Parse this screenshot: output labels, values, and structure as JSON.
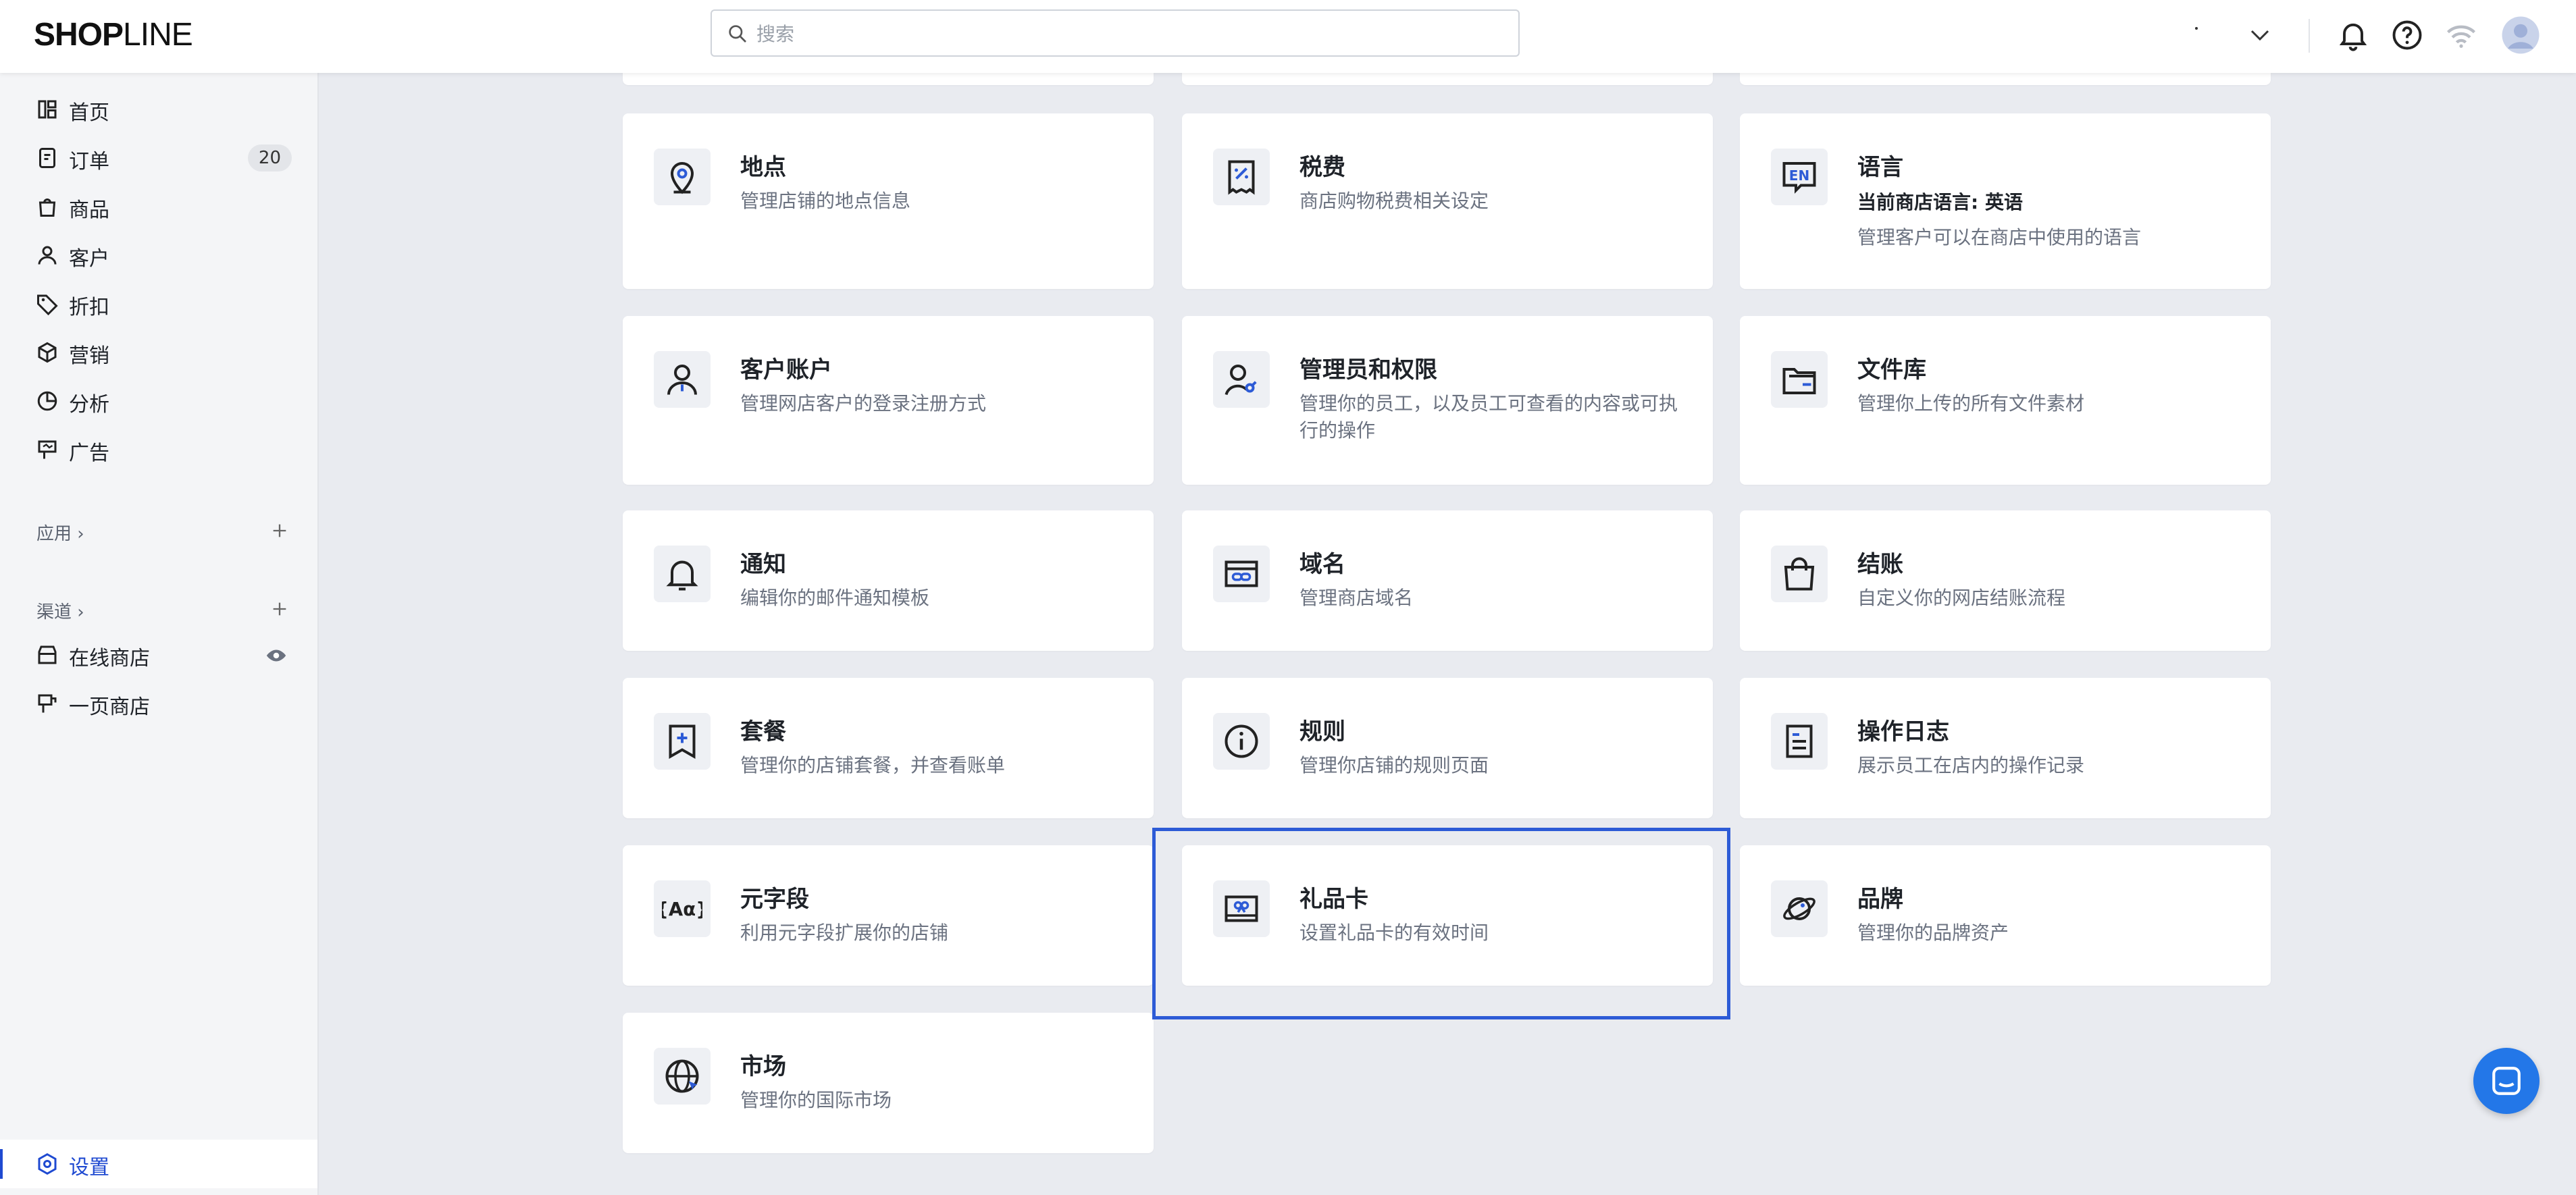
{
  "brand": {
    "logo_bold": "SHOP",
    "logo_thin": "LINE"
  },
  "search": {
    "placeholder": "搜索"
  },
  "colors": {
    "accent": "#1f4ad1",
    "highlight": "#2d5bd6",
    "chat": "#2377e8"
  },
  "sidebar": {
    "items": [
      {
        "label": "首页",
        "icon": "home-icon"
      },
      {
        "label": "订单",
        "icon": "order-icon",
        "badge": "20"
      },
      {
        "label": "商品",
        "icon": "bag-icon"
      },
      {
        "label": "客户",
        "icon": "person-icon"
      },
      {
        "label": "折扣",
        "icon": "tag-icon"
      },
      {
        "label": "营销",
        "icon": "box-icon"
      },
      {
        "label": "分析",
        "icon": "chart-icon"
      },
      {
        "label": "广告",
        "icon": "billboard-icon"
      }
    ],
    "apps_label": "应用",
    "channels_label": "渠道",
    "channels": [
      {
        "label": "在线商店",
        "icon": "store-icon"
      },
      {
        "label": "一页商店",
        "icon": "page-store-icon"
      }
    ],
    "settings_label": "设置"
  },
  "cards": {
    "location": {
      "title": "地点",
      "desc": "管理店铺的地点信息",
      "icon": "location-pin-icon"
    },
    "tax": {
      "title": "税费",
      "desc": "商店购物税费相关设定",
      "icon": "receipt-percent-icon"
    },
    "language": {
      "title": "语言",
      "sub": "当前商店语言: 英语",
      "desc": "管理客户可以在商店中使用的语言",
      "icon": "language-en-icon"
    },
    "customer_accounts": {
      "title": "客户账户",
      "desc": "管理网店客户的登录注册方式",
      "icon": "customer-account-icon"
    },
    "staff": {
      "title": "管理员和权限",
      "desc": "管理你的员工，以及员工可查看的内容或可执行的操作",
      "icon": "staff-permission-icon"
    },
    "files": {
      "title": "文件库",
      "desc": "管理你上传的所有文件素材",
      "icon": "folder-icon"
    },
    "notifications": {
      "title": "通知",
      "desc": "编辑你的邮件通知模板",
      "icon": "bell-icon"
    },
    "domains": {
      "title": "域名",
      "desc": "管理商店域名",
      "icon": "domain-link-icon"
    },
    "checkout": {
      "title": "结账",
      "desc": "自定义你的网店结账流程",
      "icon": "shopping-bag-icon"
    },
    "plan": {
      "title": "套餐",
      "desc": "管理你的店铺套餐，并查看账单",
      "icon": "plan-bookmark-icon"
    },
    "policies": {
      "title": "规则",
      "desc": "管理你店铺的规则页面",
      "icon": "info-circle-icon"
    },
    "logs": {
      "title": "操作日志",
      "desc": "展示员工在店内的操作记录",
      "icon": "log-document-icon"
    },
    "metafields": {
      "title": "元字段",
      "desc": "利用元字段扩展你的店铺",
      "icon": "metafield-braces-icon"
    },
    "gift_cards": {
      "title": "礼品卡",
      "desc": "设置礼品卡的有效时间",
      "icon": "gift-card-icon"
    },
    "brand": {
      "title": "品牌",
      "desc": "管理你的品牌资产",
      "icon": "brand-planet-icon"
    },
    "markets": {
      "title": "市场",
      "desc": "管理你的国际市场",
      "icon": "globe-icon"
    }
  }
}
